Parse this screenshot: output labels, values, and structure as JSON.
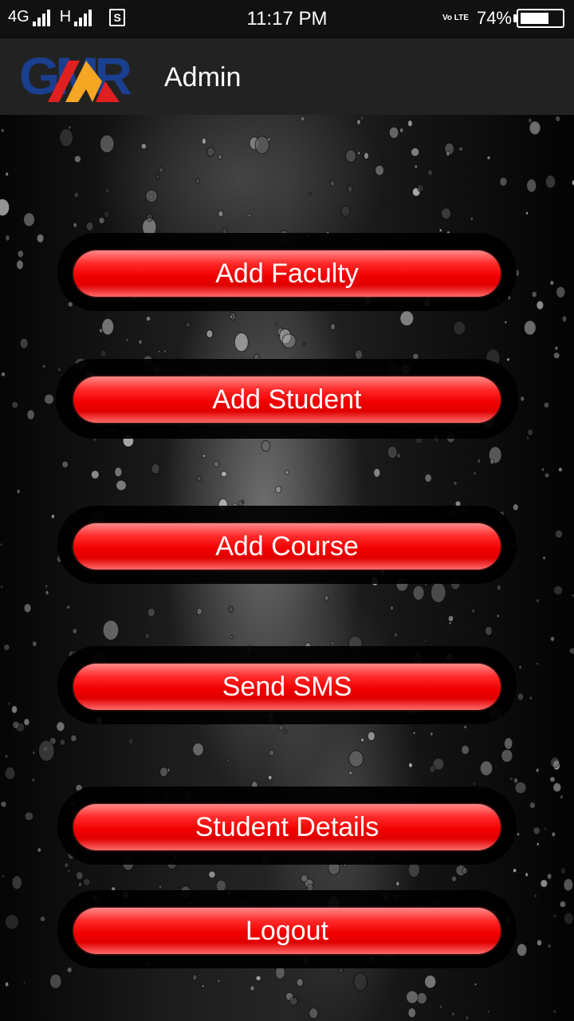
{
  "status_bar": {
    "network_left": "4G",
    "network_right": "H",
    "sim_label": "S",
    "time": "11:17 PM",
    "volte": "Vo LTE",
    "battery_percent": "74%",
    "battery_level": 0.74
  },
  "app_bar": {
    "logo_text": "GMR",
    "title": "Admin"
  },
  "menu": {
    "buttons": [
      {
        "label": "Add Faculty"
      },
      {
        "label": "Add Student"
      },
      {
        "label": "Add Course"
      },
      {
        "label": "Send SMS"
      },
      {
        "label": "Student Details"
      },
      {
        "label": "Logout"
      }
    ]
  },
  "colors": {
    "button_red": "#f00000",
    "app_bar": "#222222",
    "logo_blue": "#1b3f8f",
    "logo_red": "#e02020",
    "logo_orange": "#f5a623"
  }
}
